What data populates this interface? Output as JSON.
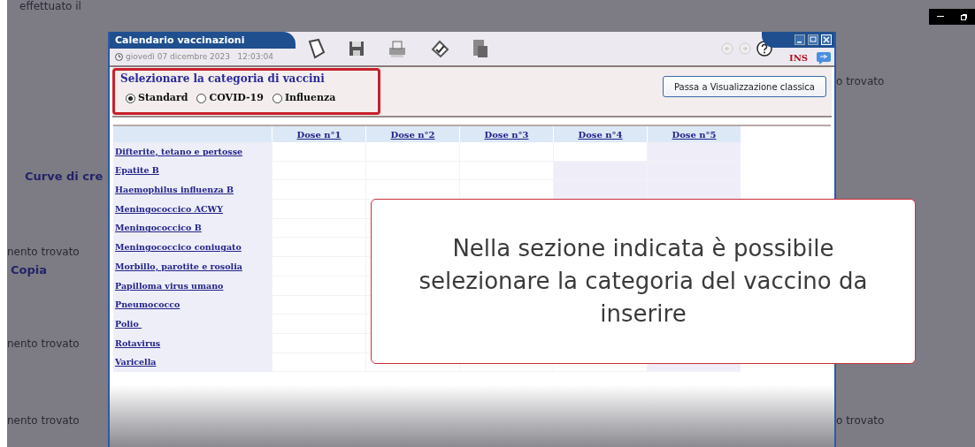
{
  "background": {
    "top_text": "effettuato il",
    "left_texts": [
      {
        "kind": "link",
        "text": "Curve di cre"
      },
      {
        "kind": "plain",
        "text": "nento trovato"
      },
      {
        "kind": "link",
        "text": "Copia"
      },
      {
        "kind": "plain",
        "text": "nento trovato"
      },
      {
        "kind": "plain",
        "text": "nento trovato"
      }
    ],
    "right_texts": [
      "o trovato",
      "o trovato"
    ]
  },
  "window": {
    "title": "Calendario vaccinazioni",
    "datetime": "giovedì 07 dicembre 2023   12:03:04",
    "mode": "INS"
  },
  "category": {
    "heading": "Selezionare la categoria di vaccini",
    "options": [
      {
        "label": "Standard",
        "selected": true
      },
      {
        "label": "COVID-19",
        "selected": false
      },
      {
        "label": "Influenza",
        "selected": false
      }
    ]
  },
  "classic_button": "Passa a Visualizzazione classica",
  "table": {
    "columns": [
      "Dose n°1",
      "Dose n°2",
      "Dose n°3",
      "Dose n°4",
      "Dose n°5"
    ],
    "rows": [
      "Difterite, tetano e pertosse",
      "Epatite B",
      "Haemophilus influenza B",
      "Meningococcico ACWY",
      "Meningococcico B",
      "Meningococcico coniugato",
      "Morbillo, parotite e rosolia",
      "Papilloma virus umano",
      "Pneumococco",
      "Polio ",
      "Rotavirus",
      "Varicella"
    ]
  },
  "callout": "Nella sezione indicata è possibile selezionare la categoria del vaccino da inserire"
}
